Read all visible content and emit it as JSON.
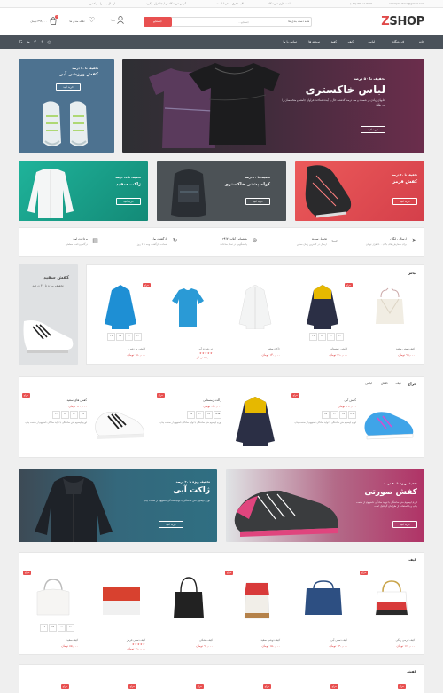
{
  "topbar": {
    "email": "example.store@gmail.com",
    "phone": "(۰۲۱) ۹۵۵-۱۱۱۲-۱۲",
    "address": "آدرس فروشگاه در اینجا قرار میگیرد",
    "shipping": "ارسال به سراسر کشور",
    "hours": "ساعت کاری فروشگاه",
    "rights": "کلیه حقوق محفوظ است"
  },
  "header": {
    "logo_prefix": "Z",
    "logo_text": "SHOP",
    "search_category": "همه دسته بندی ها",
    "search_placeholder": "جستجو...",
    "search_button": "جستجو",
    "login": "ورود",
    "register": "ثبت نام",
    "wishlist": "علاقه مندی ها",
    "cart_badge": "۱",
    "cart_total": "۳۹۹,۰۰۰ تومان",
    "wishlist_badge": "۰"
  },
  "nav": {
    "items": [
      "خانه",
      "فروشگاه",
      "لباس",
      "کیف",
      "کفش",
      "نوشته ها",
      "تماس با ما"
    ],
    "social": [
      "instagram-icon",
      "facebook-icon",
      "twitter-icon",
      "googleplus-icon"
    ]
  },
  "hero": {
    "main": {
      "discount": "تخفیف تا ۵۰ درصد",
      "title": "لباس خاکستری",
      "desc": "کتابهای زیادی در شصت و سه درصد گذشته، حال و آینده شناخت فراوان جامعه و متخصصان را می طلبد",
      "button": "خرید کنید"
    },
    "side": {
      "discount": "تخفیف تا ۶۰ درصد",
      "title": "کفش ورزشی آبی",
      "button": "خرید کنید"
    }
  },
  "promo_row": [
    {
      "discount": "تخفیف تا ۶۰ درصد",
      "title": "کفش قرمز",
      "button": "خرید کنید"
    },
    {
      "discount": "تخفیف تا ۳۰ درصد",
      "title": "کوله پشتی خاکستری",
      "button": "خرید کنید"
    },
    {
      "discount": "تخفیف تا ۲۵ درصد",
      "title": "ژاکت سفید",
      "button": "خرید کنید"
    }
  ],
  "features": [
    {
      "title": "ارسال رایگان",
      "sub": "برای سفارش های بالای ۵۰۰ هزار تومان"
    },
    {
      "title": "تحویل سریع",
      "sub": "ارسال در کمترین زمان ممکن"
    },
    {
      "title": "پشتیبانی آنلاین ۲۴/۷",
      "sub": "پاسخگویی در تمام ساعات"
    },
    {
      "title": "بازگشت پول",
      "sub": "ضمانت بازگشت وجه تا ۷ روز"
    },
    {
      "title": "پرداخت امن",
      "sub": "درگاه پرداخت مطمئن"
    }
  ],
  "sidebanner": {
    "title": "کفش سفید",
    "sub": "تخفیف ویژه تا ۳۰ درصد"
  },
  "section_clothes": {
    "title": "لباس",
    "products": [
      {
        "name": "کیف دستی سفید",
        "price": "۹۵,۰۰۰ تومان",
        "sale": false
      },
      {
        "name": "کاپشن زمستانی",
        "price": "۲۱۰,۰۰۰ تومان",
        "sale": true,
        "countdown": [
          "۱۲",
          "۰۴",
          "۳۵",
          "۲۷"
        ]
      },
      {
        "name": "ژاکت سفید",
        "price": "۱۴۰,۰۰۰ تومان",
        "sale": false
      },
      {
        "name": "تی شرت آبی",
        "price": "۶۵,۰۰۰ تومان",
        "sale": false
      },
      {
        "name": "کاپشن ورزشی",
        "price": "۱۸۰,۰۰۰ تومان",
        "sale": true,
        "countdown": [
          "۱۲",
          "۰۴",
          "۳۵",
          "۲۷"
        ]
      }
    ],
    "sale_label": "حراج",
    "cd_labels": [
      "روز",
      "ساعت",
      "دقیقه",
      "ثانیه"
    ]
  },
  "section_sale": {
    "title": "حراج",
    "tabs": [
      "کیف",
      "کفش",
      "لباس"
    ],
    "products": [
      {
        "name": "کفش آبی",
        "price": "۱۹۰,۰۰۰ تومان",
        "old": "۲۲۰,۰۰۰",
        "countdown": [
          "۲۴۹۹",
          "۱۸",
          "۴۲",
          "۱۵"
        ],
        "desc": "لورم ایپسوم متن ساختگی با تولید سادگی نامفهوم از صنعت چاپ"
      },
      {
        "name": "ژاکت زمستانی",
        "price": "۲۴۰,۰۰۰ تومان",
        "old": "۲۸۰,۰۰۰",
        "countdown": [
          "۲۷۹۵",
          "۱۸",
          "۴۲",
          "۱۵"
        ],
        "desc": "لورم ایپسوم متن ساختگی با تولید سادگی نامفهوم از صنعت چاپ"
      },
      {
        "name": "کفش های سفید",
        "price": "۱۲۰,۰۰۰ تومان",
        "old": "۱۵۰,۰۰۰",
        "countdown": [
          "۱۸",
          "۲۳",
          "۱۵",
          "۴۲"
        ],
        "desc": "لورم ایپسوم متن ساختگی با تولید سادگی نامفهوم از صنعت چاپ"
      }
    ]
  },
  "promo_big": [
    {
      "discount": "تخفیف ویژه تا ۵۰ درصد",
      "title": "کفش صورتی",
      "desc": "لورم ایپسوم متن ساختگی با تولید سادگی نامفهوم از صنعت چاپ و با استفاده از طراحان گرافیک است",
      "button": "خرید کنید"
    },
    {
      "discount": "تخفیف ویژه تا ۴۰ درصد",
      "title": "ژاکت آبی",
      "desc": "لورم ایپسوم متن ساختگی با تولید سادگی نامفهوم از صنعت چاپ",
      "button": "خرید کنید"
    }
  ],
  "section_bags": {
    "title": "کیف",
    "products": [
      {
        "name": "کیف چرمی رنگی",
        "price": "۱۶۰,۰۰۰ تومان",
        "sale": true
      },
      {
        "name": "کیف دستی آبی",
        "price": "۱۳۰,۰۰۰ تومان",
        "sale": false
      },
      {
        "name": "کیف دوشی سفید",
        "price": "۱۵۰,۰۰۰ تومان",
        "sale": true
      },
      {
        "name": "کیف مشکی",
        "price": "۹۰,۰۰۰ تومان",
        "sale": false
      },
      {
        "name": "کیف دستی قرمز",
        "price": "۱۱۰,۰۰۰ تومان",
        "sale": false
      },
      {
        "name": "کیف سفید",
        "price": "۸۵,۰۰۰ تومان",
        "sale": true
      }
    ]
  },
  "section_shoes": {
    "title": "کفش"
  },
  "colors": {
    "accent": "#e85050",
    "nav": "#4a525a",
    "dark": "#333333"
  }
}
